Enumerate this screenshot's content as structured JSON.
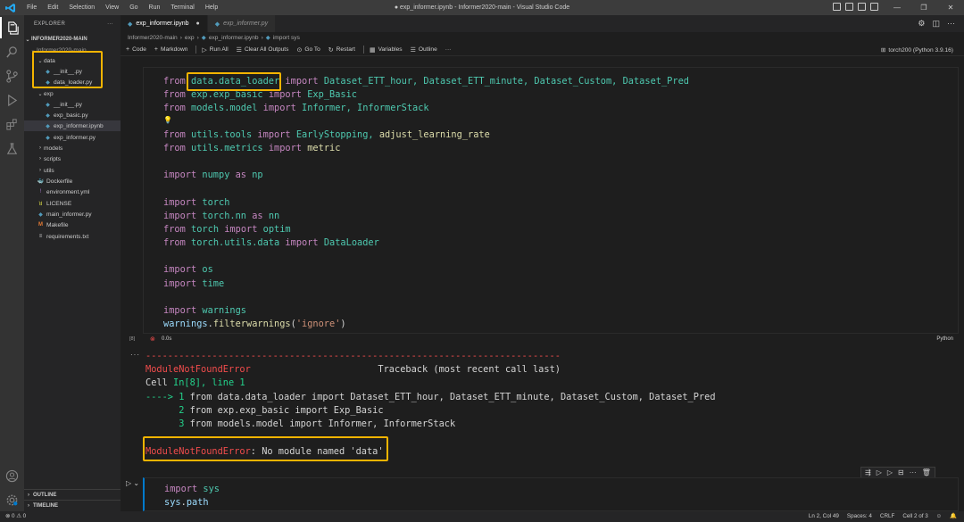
{
  "window": {
    "title": "● exp_informer.ipynb - Informer2020-main - Visual Studio Code",
    "menu": [
      "File",
      "Edit",
      "Selection",
      "View",
      "Go",
      "Run",
      "Terminal",
      "Help"
    ],
    "controls": [
      "—",
      "❐",
      "✕"
    ]
  },
  "sidebar": {
    "header": "EXPLORER",
    "more": "···",
    "root": "INFORMER2020-MAIN",
    "folder": "Informer2020-main",
    "items": [
      {
        "label": "data",
        "kind": "folder-open",
        "icon": "chevron-down"
      },
      {
        "label": "__init__.py",
        "kind": "py"
      },
      {
        "label": "data_loader.py",
        "kind": "py"
      },
      {
        "label": "exp",
        "kind": "folder-open"
      },
      {
        "label": "__init__.py",
        "kind": "py"
      },
      {
        "label": "exp_basic.py",
        "kind": "py"
      },
      {
        "label": "exp_informer.ipynb",
        "kind": "ipynb"
      },
      {
        "label": "exp_informer.py",
        "kind": "py"
      },
      {
        "label": "models",
        "kind": "folder"
      },
      {
        "label": "scripts",
        "kind": "folder"
      },
      {
        "label": "utils",
        "kind": "folder"
      },
      {
        "label": "Dockerfile",
        "kind": "docker"
      },
      {
        "label": "environment.yml",
        "kind": "yml"
      },
      {
        "label": "LICENSE",
        "kind": "license"
      },
      {
        "label": "main_informer.py",
        "kind": "py"
      },
      {
        "label": "Makefile",
        "kind": "make"
      },
      {
        "label": "requirements.txt",
        "kind": "txt"
      }
    ],
    "outline": "OUTLINE",
    "timeline": "TIMELINE"
  },
  "tabs": [
    {
      "label": "exp_informer.ipynb",
      "active": true,
      "close": "●"
    },
    {
      "label": "exp_informer.py",
      "active": false
    }
  ],
  "breadcrumb": [
    "Informer2020-main",
    "exp",
    "exp_informer.ipynb",
    "import sys"
  ],
  "toolbar": {
    "code": "Code",
    "markdown": "Markdown",
    "run_all": "Run All",
    "clear": "Clear All Outputs",
    "goto": "Go To",
    "restart": "Restart",
    "variables": "Variables",
    "outline": "Outline",
    "more": "···",
    "kernel": "torch200 (Python 3.9.16)"
  },
  "cell": {
    "exec_count": "[8]",
    "exec_time": "0.0s",
    "language": "Python",
    "code": {
      "l1_kw": "from",
      "l1_mod": "data.data_loader",
      "l1_kw2": "import",
      "l1_rest": " Dataset_ETT_hour, Dataset_ETT_minute, Dataset_Custom, Dataset_Pred",
      "l2_kw": "from",
      "l2_mod": "exp.exp_basic",
      "l2_kw2": "import",
      "l2_rest": " Exp_Basic",
      "l3_kw": "from",
      "l3_mod": "models.model",
      "l3_kw2": "import",
      "l3_rest": " Informer, InformerStack",
      "l4_icon": "💡",
      "l5_kw": "from",
      "l5_mod": "utils.tools",
      "l5_kw2": "import",
      "l5_rest1": " EarlyStopping, ",
      "l5_fn": "adjust_learning_rate",
      "l6_kw": "from",
      "l6_mod": "utils.metrics",
      "l6_kw2": "import",
      "l6_rest": " metric",
      "l7_kw": "import",
      "l7_mod": "numpy",
      "l7_kw2": "as",
      "l7_rest": " np",
      "l8_kw": "import",
      "l8_mod": "torch",
      "l9_kw": "import",
      "l9_mod": "torch.nn",
      "l9_kw2": "as",
      "l9_rest": " nn",
      "l10_kw": "from",
      "l10_mod": "torch",
      "l10_kw2": "import",
      "l10_rest": " optim",
      "l11_kw": "from",
      "l11_mod": "torch.utils.data",
      "l11_kw2": "import",
      "l11_rest": " DataLoader",
      "l12_kw": "import",
      "l12_mod": "os",
      "l13_kw": "import",
      "l13_mod": "time",
      "l14_kw": "import",
      "l14_mod": "warnings",
      "l15_obj": "warnings",
      "l15_dot": ".",
      "l15_fn": "filterwarnings",
      "l15_open": "(",
      "l15_str": "'ignore'",
      "l15_close": ")"
    }
  },
  "output": {
    "dashes": "---------------------------------------------------------------------------",
    "err_name": "ModuleNotFoundError",
    "traceback": "Traceback (most recent call last)",
    "cell_prefix": "Cell ",
    "cell_ref": "In[8], line 1",
    "arrow": "----> 1",
    "tb1": " from data.data_loader import Dataset_ETT_hour, Dataset_ETT_minute, Dataset_Custom, Dataset_Pred",
    "num2": "      2",
    "tb2": " from exp.exp_basic import Exp_Basic",
    "num3": "      3",
    "tb3": " from models.model import Informer, InformerStack",
    "final_name": "ModuleNotFoundError",
    "final_msg": ": No module named 'data'"
  },
  "cell2": {
    "l1_kw": "import",
    "l1_mod": "sys",
    "l2_obj": "sys",
    "l2_dot": ".",
    "l2_attr": "path",
    "toolbar": [
      "⇶",
      "▷",
      "▷",
      "⊟",
      "···",
      "🗑"
    ]
  },
  "status": {
    "left": "⊗ 0 ⚠ 0",
    "pos": "Ln 2, Col 49",
    "spaces": "Spaces: 4",
    "eol": "CRLF",
    "cell": "Cell 2 of 3",
    "feedback": "☺",
    "bell": "🔔"
  },
  "colors": {
    "highlight": "#f5b400",
    "error": "#f14c4c",
    "accent": "#007acc"
  }
}
